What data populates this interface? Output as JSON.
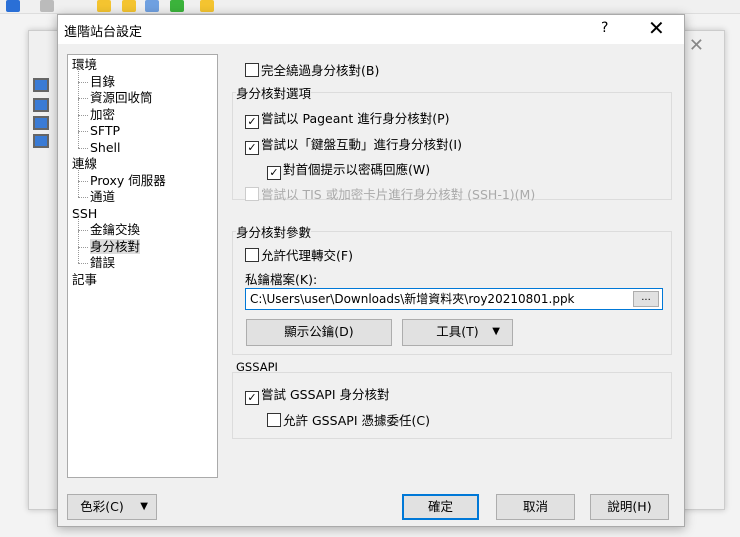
{
  "dialog": {
    "title": "進階站台設定",
    "help": "?",
    "close": "✕"
  },
  "tree": [
    {
      "label": "環境",
      "level": 0
    },
    {
      "label": "目錄",
      "level": 1
    },
    {
      "label": "資源回收筒",
      "level": 1
    },
    {
      "label": "加密",
      "level": 1
    },
    {
      "label": "SFTP",
      "level": 1
    },
    {
      "label": "Shell",
      "level": 1
    },
    {
      "label": "連線",
      "level": 0
    },
    {
      "label": "Proxy 伺服器",
      "level": 1
    },
    {
      "label": "通道",
      "level": 1
    },
    {
      "label": "SSH",
      "level": 0
    },
    {
      "label": "金鑰交換",
      "level": 1
    },
    {
      "label": "身分核對",
      "level": 1,
      "selected": true
    },
    {
      "label": "錯誤",
      "level": 1
    },
    {
      "label": "記事",
      "level": 0
    }
  ],
  "auth": {
    "bypass": {
      "label": "完全繞過身分核對(B)",
      "checked": false
    },
    "options_group": "身分核對選項",
    "pageant": {
      "label": "嘗試以 Pageant 進行身分核對(P)",
      "checked": true
    },
    "keyboard": {
      "label": "嘗試以「鍵盤互動」進行身分核對(I)",
      "checked": true
    },
    "first_prompt": {
      "label": "對首個提示以密碼回應(W)",
      "checked": true
    },
    "tis": {
      "label": "嘗試以 TIS 或加密卡片進行身分核對 (SSH-1)(M)",
      "checked": false,
      "disabled": true
    },
    "params_group": "身分核對參數",
    "agent_fwd": {
      "label": "允許代理轉交(F)",
      "checked": false
    },
    "keyfile_label": "私鑰檔案(K):",
    "keyfile_value": "C:\\Users\\user\\Downloads\\新增資料夾\\roy20210801.ppk",
    "browse": "...",
    "show_pubkey": "顯示公鑰(D)",
    "tools": "工具(T)",
    "gssapi_group": "GSSAPI",
    "gssapi_try": {
      "label": "嘗試 GSSAPI 身分核對",
      "checked": true
    },
    "gssapi_deleg": {
      "label": "允許 GSSAPI 憑據委任(C)",
      "checked": false
    }
  },
  "footer": {
    "color": "色彩(C)",
    "ok": "確定",
    "cancel": "取消",
    "help": "說明(H)"
  }
}
